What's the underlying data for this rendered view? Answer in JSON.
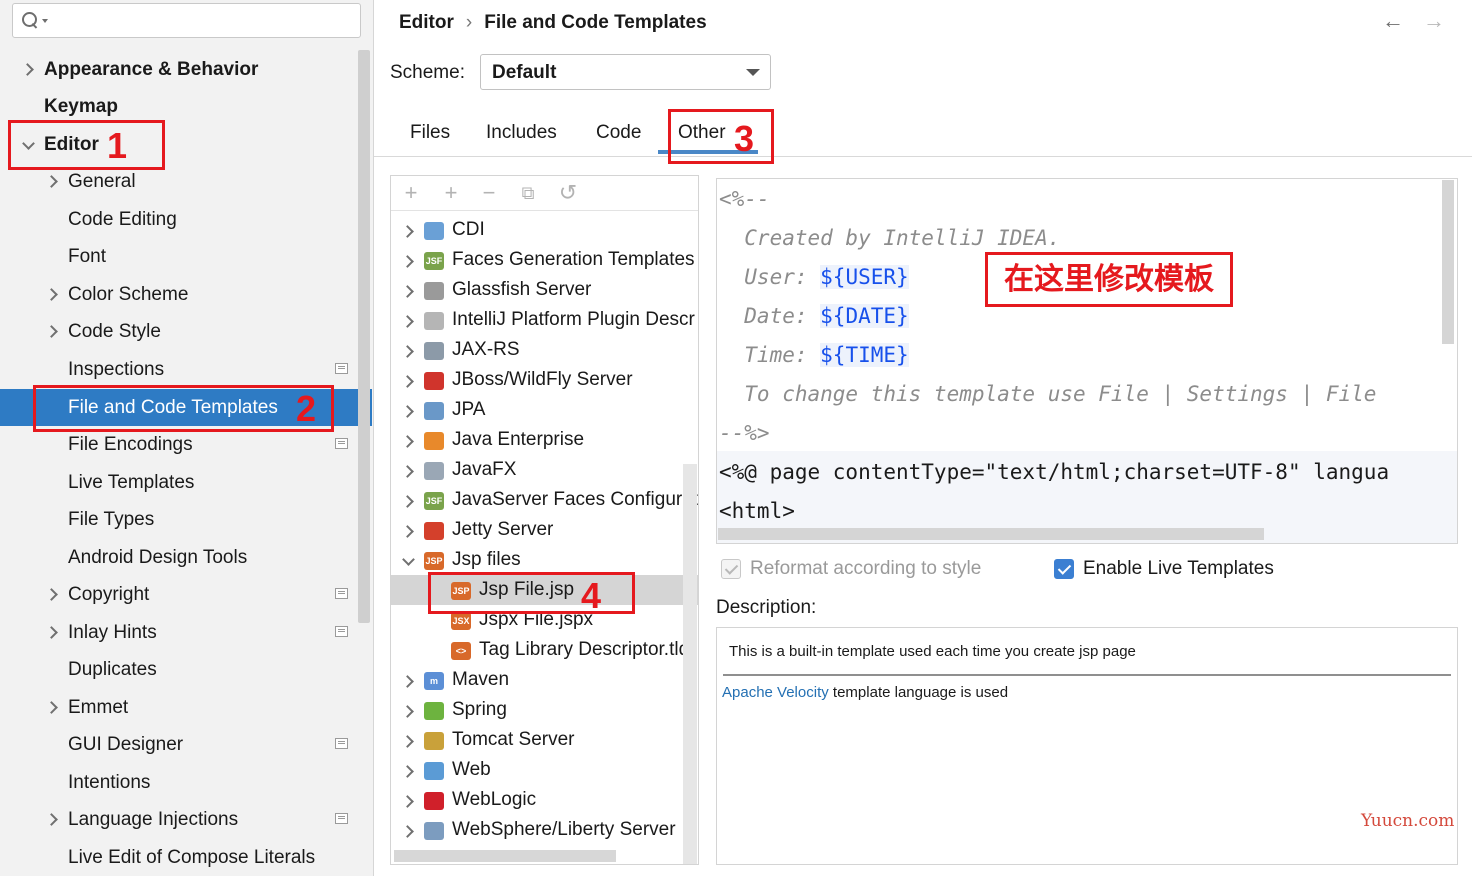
{
  "search": {
    "placeholder": ""
  },
  "sidebar": {
    "items": [
      {
        "label": "Appearance & Behavior",
        "arrow": "right",
        "bold": true
      },
      {
        "label": "Keymap",
        "arrow": "none",
        "bold": true
      },
      {
        "label": "Editor",
        "arrow": "down",
        "bold": true
      },
      {
        "label": "General",
        "arrow": "right"
      },
      {
        "label": "Code Editing",
        "arrow": "none"
      },
      {
        "label": "Font",
        "arrow": "none"
      },
      {
        "label": "Color Scheme",
        "arrow": "right"
      },
      {
        "label": "Code Style",
        "arrow": "right"
      },
      {
        "label": "Inspections",
        "arrow": "none",
        "project_icon": true
      },
      {
        "label": "File and Code Templates",
        "arrow": "none",
        "selected": true
      },
      {
        "label": "File Encodings",
        "arrow": "none",
        "project_icon": true
      },
      {
        "label": "Live Templates",
        "arrow": "none"
      },
      {
        "label": "File Types",
        "arrow": "none"
      },
      {
        "label": "Android Design Tools",
        "arrow": "none"
      },
      {
        "label": "Copyright",
        "arrow": "right",
        "project_icon": true
      },
      {
        "label": "Inlay Hints",
        "arrow": "right",
        "project_icon": true
      },
      {
        "label": "Duplicates",
        "arrow": "none"
      },
      {
        "label": "Emmet",
        "arrow": "right"
      },
      {
        "label": "GUI Designer",
        "arrow": "none",
        "project_icon": true
      },
      {
        "label": "Intentions",
        "arrow": "none"
      },
      {
        "label": "Language Injections",
        "arrow": "right",
        "project_icon": true
      },
      {
        "label": "Live Edit of Compose Literals",
        "arrow": "none"
      }
    ]
  },
  "breadcrumb": {
    "parent": "Editor",
    "separator": "›",
    "current": "File and Code Templates"
  },
  "nav": {
    "back": "←",
    "forward": "→"
  },
  "scheme": {
    "label": "Scheme:",
    "value": "Default"
  },
  "tabs": [
    {
      "label": "Files"
    },
    {
      "label": "Includes"
    },
    {
      "label": "Code"
    },
    {
      "label": "Other",
      "active": true
    }
  ],
  "toolbar": {
    "add": "+",
    "add_child": "+",
    "remove": "−",
    "copy": "⧉",
    "reset": "↺"
  },
  "templates": [
    {
      "label": "CDI",
      "icon": "cdi-icon",
      "arrow": "right",
      "level": 0
    },
    {
      "label": "Faces Generation Templates",
      "icon": "jsf-icon",
      "arrow": "right",
      "level": 0
    },
    {
      "label": "Glassfish Server",
      "icon": "glassfish-icon",
      "arrow": "right",
      "level": 0
    },
    {
      "label": "IntelliJ Platform Plugin Descr",
      "icon": "plugin-icon",
      "arrow": "right",
      "level": 0
    },
    {
      "label": "JAX-RS",
      "icon": "jaxrs-icon",
      "arrow": "right",
      "level": 0
    },
    {
      "label": "JBoss/WildFly Server",
      "icon": "jboss-icon",
      "arrow": "right",
      "level": 0
    },
    {
      "label": "JPA",
      "icon": "jpa-icon",
      "arrow": "right",
      "level": 0
    },
    {
      "label": "Java Enterprise",
      "icon": "java-ee-icon",
      "arrow": "right",
      "level": 0
    },
    {
      "label": "JavaFX",
      "icon": "javafx-icon",
      "arrow": "right",
      "level": 0
    },
    {
      "label": "JavaServer Faces Configuratic",
      "icon": "jsf-icon",
      "arrow": "right",
      "level": 0
    },
    {
      "label": "Jetty Server",
      "icon": "jetty-icon",
      "arrow": "right",
      "level": 0
    },
    {
      "label": "Jsp files",
      "icon": "jsp-icon",
      "arrow": "down",
      "level": 0
    },
    {
      "label": "Jsp File.jsp",
      "icon": "jsp-icon",
      "arrow": "none",
      "level": 1,
      "selected": true
    },
    {
      "label": "Jspx File.jspx",
      "icon": "jspx-icon",
      "arrow": "none",
      "level": 1
    },
    {
      "label": "Tag Library Descriptor.tld",
      "icon": "tld-icon",
      "arrow": "none",
      "level": 1
    },
    {
      "label": "Maven",
      "icon": "maven-icon",
      "arrow": "right",
      "level": 0
    },
    {
      "label": "Spring",
      "icon": "spring-icon",
      "arrow": "right",
      "level": 0
    },
    {
      "label": "Tomcat Server",
      "icon": "tomcat-icon",
      "arrow": "right",
      "level": 0
    },
    {
      "label": "Web",
      "icon": "web-icon",
      "arrow": "right",
      "level": 0
    },
    {
      "label": "WebLogic",
      "icon": "weblogic-icon",
      "arrow": "right",
      "level": 0
    },
    {
      "label": "WebSphere/Liberty Server",
      "icon": "websphere-icon",
      "arrow": "right",
      "level": 0
    }
  ],
  "editor": {
    "lines": [
      {
        "kind": "comment",
        "text": "<%--"
      },
      {
        "kind": "comment",
        "text": "  Created by IntelliJ IDEA."
      },
      {
        "kind": "comment",
        "text": "  User: ",
        "var": "${USER}"
      },
      {
        "kind": "comment",
        "text": "  Date: ",
        "var": "${DATE}"
      },
      {
        "kind": "comment",
        "text": "  Time: ",
        "var": "${TIME}"
      },
      {
        "kind": "comment",
        "text": "  To change this template use File | Settings | File"
      },
      {
        "kind": "comment",
        "text": "--%>"
      },
      {
        "kind": "plain",
        "text": "<%@ page contentType=\"text/html;charset=UTF-8\" langua"
      },
      {
        "kind": "plain",
        "text": "<html>"
      }
    ]
  },
  "options": {
    "reformat": {
      "label": "Reformat according to style",
      "checked": true,
      "disabled": true
    },
    "live_templates": {
      "label": "Enable Live Templates",
      "checked": true,
      "disabled": false
    }
  },
  "description": {
    "label": "Description:",
    "text": "This is a built-in template used each time you create jsp page",
    "link": "Apache Velocity",
    "suffix": " template language is used"
  },
  "annotations": {
    "marker_1": "1",
    "marker_2": "2",
    "marker_3": "3",
    "marker_4": "4",
    "note": "在这里修改模板",
    "color": "#e5191e"
  },
  "watermark": "Yuucn.com",
  "colors": {
    "selection": "#2e7bc4",
    "link": "#2470b3",
    "template_var": "#1750eb",
    "checkbox": "#3b7fd2"
  }
}
